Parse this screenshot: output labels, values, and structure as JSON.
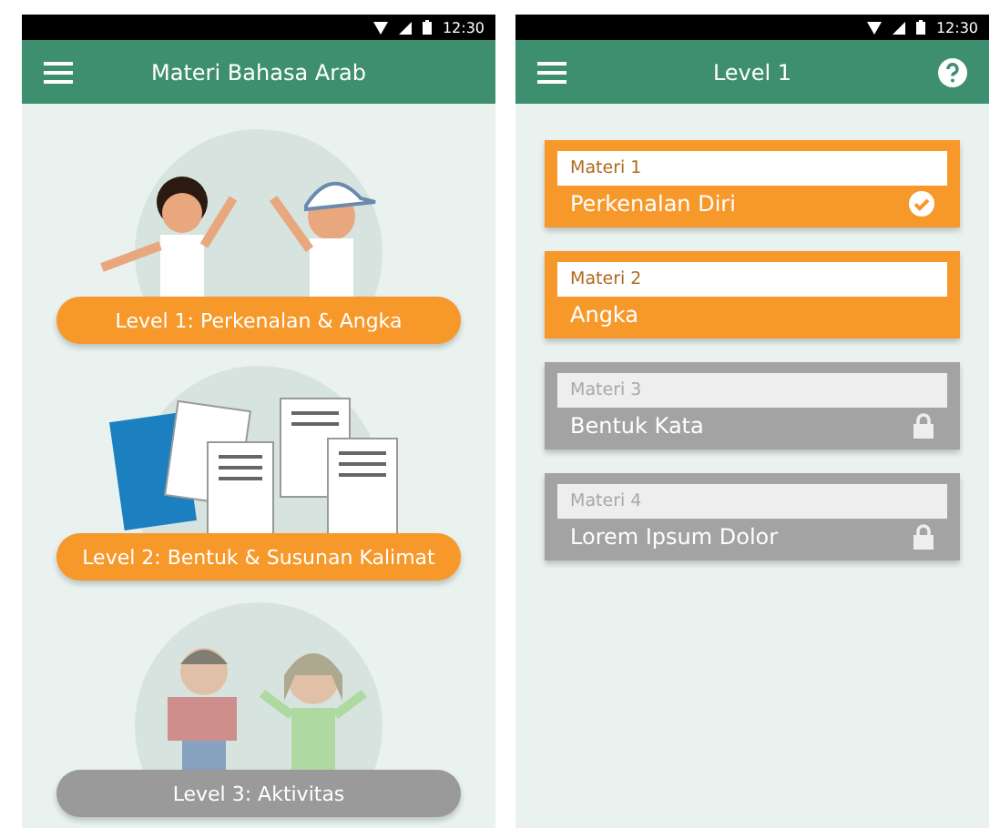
{
  "screens": [
    {
      "status_bar": {
        "time": "12:30"
      },
      "app_bar": {
        "title": "Materi Bahasa Arab",
        "help": false
      },
      "levels": [
        {
          "label": "Level 1:  Perkenalan & Angka",
          "kind": "kids",
          "locked": false
        },
        {
          "label": "Level 2:  Bentuk & Susunan Kalimat",
          "kind": "papers",
          "locked": false
        },
        {
          "label": "Level 3:  Aktivitas",
          "kind": "readers",
          "locked": true
        }
      ]
    },
    {
      "status_bar": {
        "time": "12:30"
      },
      "app_bar": {
        "title": "Level 1",
        "help": true
      },
      "materials": [
        {
          "number": "Materi 1",
          "title": "Perkenalan Diri",
          "locked": false,
          "completed": true
        },
        {
          "number": "Materi 2",
          "title": "Angka",
          "locked": false,
          "completed": false
        },
        {
          "number": "Materi 3",
          "title": "Bentuk Kata",
          "locked": true,
          "completed": false
        },
        {
          "number": "Materi 4",
          "title": "Lorem Ipsum Dolor",
          "locked": true,
          "completed": false
        }
      ]
    }
  ]
}
